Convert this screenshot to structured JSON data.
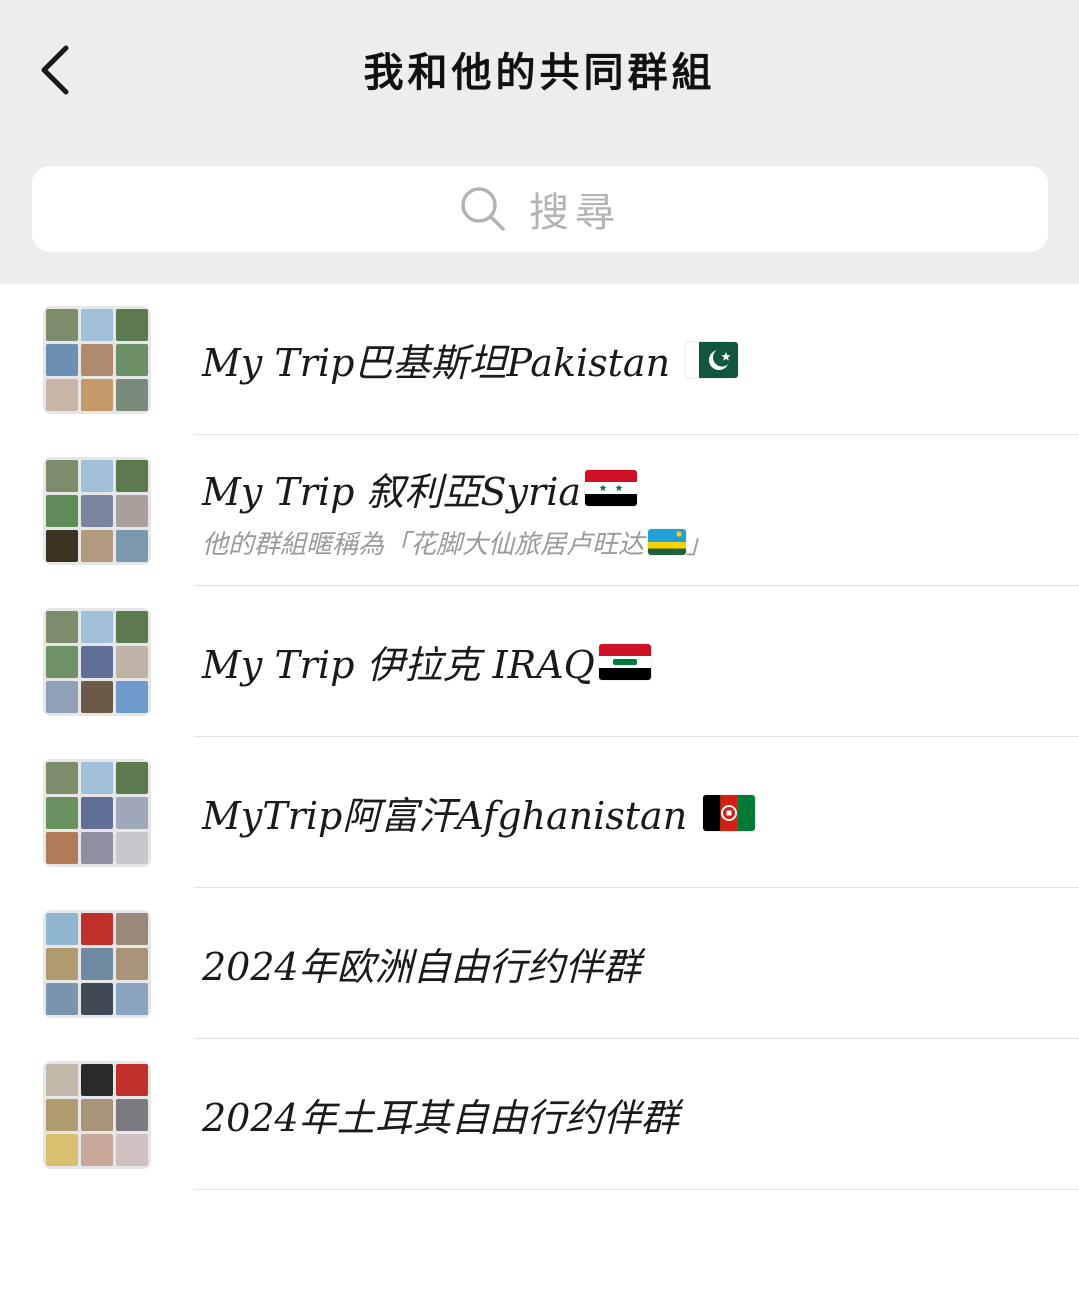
{
  "header": {
    "title": "我和他的共同群組",
    "back_icon": "chevron-left-icon"
  },
  "search": {
    "placeholder": "搜尋",
    "icon": "search-icon"
  },
  "groups": [
    {
      "name": "My Trip巴基斯坦Pakistan",
      "flag": "flag-pakistan",
      "subtitle": "",
      "avatar_colors": [
        "#7d8c6a",
        "#9fc0d8",
        "#5c7a4e",
        "#6a8fb0",
        "#b08a6e",
        "#6d8f66",
        "#c9b5a8",
        "#c49a68",
        "#7a8a7a"
      ]
    },
    {
      "name": "My Trip 叙利亞Syria",
      "flag": "flag-syria",
      "subtitle": "他的群組暱稱為「花脚大仙旅居卢旺达",
      "subtitle_flag": "flag-rwanda",
      "subtitle_end": "」",
      "avatar_colors": [
        "#7d8c6a",
        "#9fc0d8",
        "#5c7a4e",
        "#5f8a5a",
        "#7a86a0",
        "#a8a09a",
        "#3a3320",
        "#b09a80",
        "#7b98ad"
      ]
    },
    {
      "name": "My Trip 伊拉克 IRAQ",
      "flag": "flag-iraq",
      "subtitle": "",
      "avatar_colors": [
        "#7d8c6a",
        "#9fc0d8",
        "#5c7a4e",
        "#6e9166",
        "#5f6f95",
        "#bfb3a8",
        "#8fa0b8",
        "#6b5a48",
        "#6f9acc"
      ]
    },
    {
      "name": "MyTrip阿富汗Afghanistan",
      "flag": "flag-afghanistan",
      "subtitle": "",
      "avatar_colors": [
        "#7d8c6a",
        "#9fc0d8",
        "#5c7a4e",
        "#6a9060",
        "#5f6f95",
        "#9fa8b8",
        "#b07a58",
        "#8b8fa0",
        "#c8c8cc"
      ]
    },
    {
      "name": "2024年欧洲自由行约伴群",
      "flag": "",
      "subtitle": "",
      "avatar_colors": [
        "#8fb8d0",
        "#c0302a",
        "#9a8878",
        "#b09a70",
        "#6d8aa0",
        "#a89478",
        "#7a94b0",
        "#3f4a55",
        "#8aa4c0"
      ]
    },
    {
      "name": "2024年土耳其自由行约伴群",
      "flag": "",
      "subtitle": "",
      "avatar_colors": [
        "#c0b8a8",
        "#2a2a2a",
        "#c0302a",
        "#b09a70",
        "#a89478",
        "#7a7a80",
        "#d8c070",
        "#c8a898",
        "#d0c0c0"
      ]
    }
  ]
}
